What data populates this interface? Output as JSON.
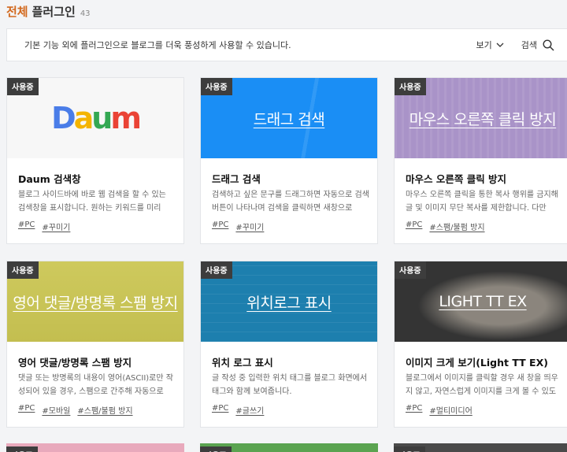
{
  "header": {
    "title_accent": "전체",
    "title_rest": "플러그인",
    "count": "43"
  },
  "info": {
    "description": "기본 기능 외에 플러그인으로 블로그를 더욱 풍성하게 사용할 수 있습니다.",
    "view_label": "보기",
    "search_label": "검색"
  },
  "badge_label": "사용중",
  "cards": [
    {
      "name": "Daum 검색창",
      "thumb_title": "",
      "logo": [
        "D",
        "a",
        "u",
        "m"
      ],
      "desc": "블로그 사이드바에 바로 웹 검색을 할 수 있는 검색창을 표시합니다. 원하는 키워드를 미리 지...",
      "tags": [
        "#PC",
        "#꾸미기"
      ],
      "bg": "#f7f7f7"
    },
    {
      "name": "드래그 검색",
      "thumb_title": "드래그 검색",
      "desc": "검색하고 싶은 문구를 드래그하면 자동으로 검색 버튼이 나타나며 검색을 클릭하면 새창으로 동...",
      "tags": [
        "#PC",
        "#꾸미기"
      ],
      "bg": "#1a8ef5"
    },
    {
      "name": "마우스 오른쪽 클릭 방지",
      "thumb_title": "마우스 오른쪽 클릭 방지",
      "desc": "마우스 오른쪽 클릭을 통한 복사 행위를 금지해 글 및 이미지 무단 복사를 제한합니다. 다만 일...",
      "tags": [
        "#PC",
        "#스팸/불펌 방지"
      ],
      "bg": "#a993c8"
    },
    {
      "name": "영어 댓글/방명록 스팸 방지",
      "thumb_title": "영어 댓글/방명록 스팸 방지",
      "desc": "댓글 또는 방명록의 내용이 영어(ASCII)로만 작성되어 있을 경우, 스팸으로 간주해 자동으로 차...",
      "tags": [
        "#PC",
        "#모바일",
        "#스팸/불펌 방지"
      ],
      "bg": "#cbc653"
    },
    {
      "name": "위치 로그 표시",
      "thumb_title": "위치로그 표시",
      "desc": "글 작성 중 입력한 위치 태그를 블로그 화면에서 태그와 함께 보여줍니다.",
      "tags": [
        "#PC",
        "#글쓰기"
      ],
      "bg": "#1d7fae"
    },
    {
      "name": "이미지 크게 보기(Light TT EX)",
      "thumb_title": "LIGHT TT EX",
      "desc": "블로그에서 이미지를 클릭할 경우 새 창을 띄우지 않고, 자연스럽게 이미지를 크게 볼 수 있도록 ...",
      "tags": [
        "#PC",
        "#멀티미디어"
      ],
      "bg": "#343434"
    }
  ],
  "colors": {
    "accent": "#d2691e",
    "daum": [
      "#4a7de8",
      "#f4b400",
      "#34a853",
      "#ea4335"
    ],
    "stubs": [
      "#e8a9bc",
      "#5aa350",
      "#4a4a4a"
    ]
  }
}
